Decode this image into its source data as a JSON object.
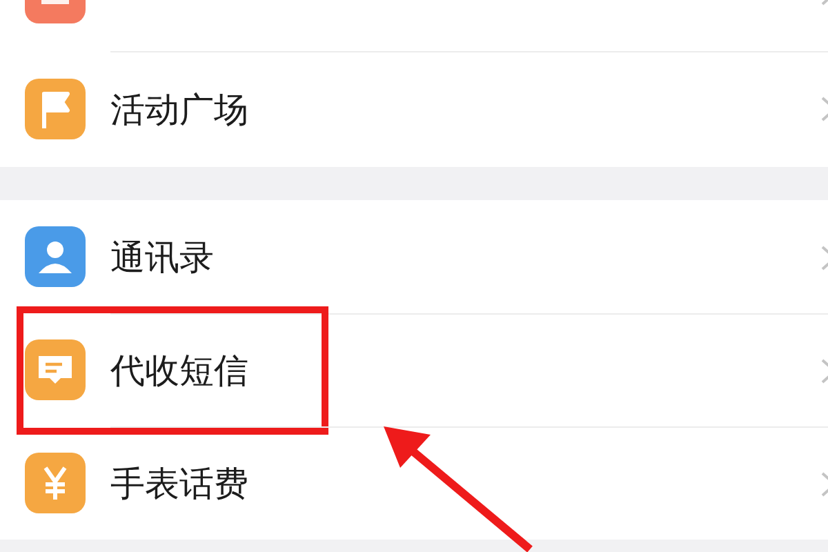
{
  "groups": [
    {
      "items": [
        {
          "color": "#f47a5f",
          "highlighted": false
        },
        {
          "label": "活动广场",
          "color": "#f5a742",
          "highlighted": false
        }
      ]
    },
    {
      "items": [
        {
          "label": "通讯录",
          "color": "#4a9be8",
          "highlighted": false
        },
        {
          "label": "代收短信",
          "color": "#f5a742",
          "highlighted": true
        },
        {
          "label": "手表话费",
          "color": "#f5a742",
          "highlighted": false
        }
      ]
    }
  ]
}
